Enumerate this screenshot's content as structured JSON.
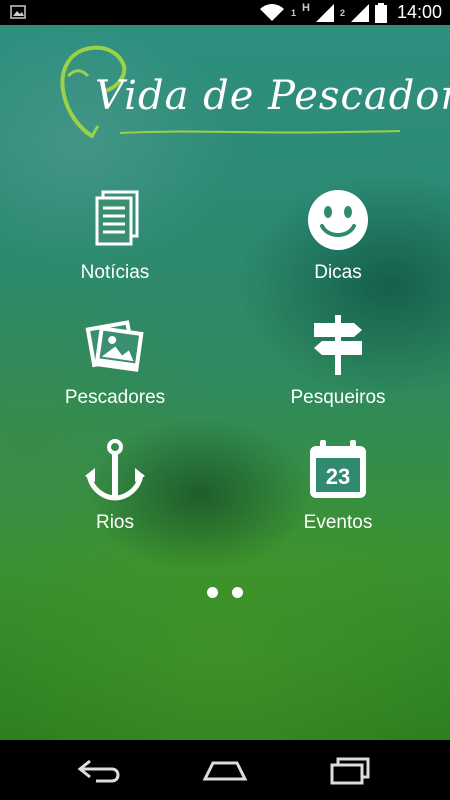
{
  "status_bar": {
    "time": "14:00",
    "sim1_label": "1",
    "sim2_label": "2",
    "network_label": "H",
    "icons": [
      "image-icon",
      "wifi-icon",
      "signal-icon",
      "signal-icon",
      "battery-icon"
    ]
  },
  "header": {
    "app_title": "Vida de Pescador",
    "logo_icon": "fish-logo-icon"
  },
  "menu": {
    "items": [
      {
        "label": "Notícias",
        "icon": "news-icon"
      },
      {
        "label": "Dicas",
        "icon": "smiley-icon"
      },
      {
        "label": "Pescadores",
        "icon": "photos-icon"
      },
      {
        "label": "Pesqueiros",
        "icon": "signpost-icon"
      },
      {
        "label": "Rios",
        "icon": "anchor-icon"
      },
      {
        "label": "Eventos",
        "icon": "calendar-icon",
        "calendar_day": "23"
      }
    ]
  },
  "pager": {
    "pages": 2,
    "current": 1
  },
  "nav_bar": {
    "icons": [
      "back-icon",
      "home-icon",
      "recents-icon"
    ]
  },
  "colors": {
    "accent": "#8cc63f",
    "text": "#ffffff",
    "background_top": "#2f8f7f",
    "background_bottom": "#2f7f1f"
  }
}
